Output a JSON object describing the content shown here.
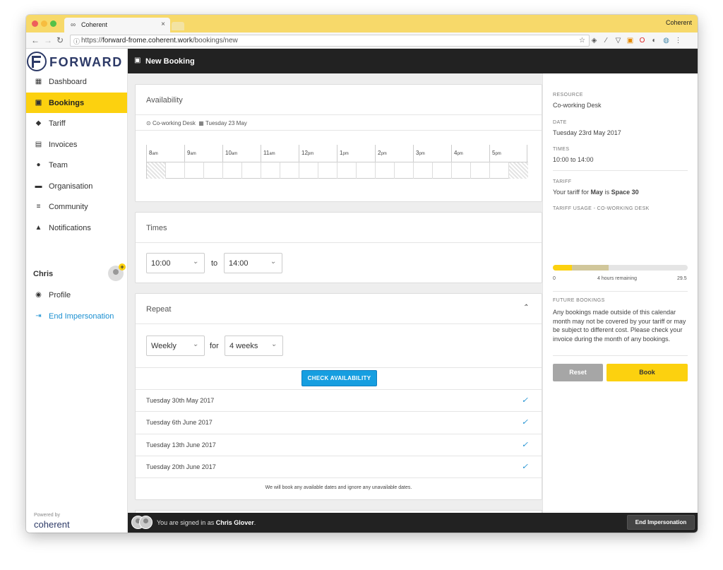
{
  "browser": {
    "tab_title": "Coherent",
    "tab_close": "×",
    "profile_name": "Coherent",
    "url_scheme": "https://",
    "url_host": "forward-frome.coherent.work",
    "url_path": "/bookings/new",
    "traffic_lights": [
      "#ee5f5b",
      "#f7bd3f",
      "#54c148"
    ],
    "extensions": [
      "star-icon",
      "layers-icon",
      "pipette-icon",
      "pocket-icon",
      "off-badge-icon",
      "opera-icon",
      "ghost-icon",
      "globe-icon",
      "more-icon"
    ]
  },
  "sidebar": {
    "brand": "FORWARD",
    "items": [
      {
        "label": "Dashboard",
        "icon": "dashboard-icon",
        "glyph": "▦"
      },
      {
        "label": "Bookings",
        "icon": "calendar-icon",
        "glyph": "▣"
      },
      {
        "label": "Tariff",
        "icon": "tag-icon",
        "glyph": "◆"
      },
      {
        "label": "Invoices",
        "icon": "document-icon",
        "glyph": "▤"
      },
      {
        "label": "Team",
        "icon": "team-icon",
        "glyph": "●"
      },
      {
        "label": "Organisation",
        "icon": "briefcase-icon",
        "glyph": "▬"
      },
      {
        "label": "Community",
        "icon": "directory-icon",
        "glyph": "≡"
      },
      {
        "label": "Notifications",
        "icon": "bell-icon",
        "glyph": "▲"
      }
    ],
    "user": {
      "name": "Chris",
      "badge": "+",
      "profile_label": "Profile",
      "end_label": "End Impersonation"
    },
    "powered_by": "Powered by",
    "powered_logo": "coherent"
  },
  "header": {
    "title": "New Booking"
  },
  "availability": {
    "title": "Availability",
    "resource": "Co-working Desk",
    "date": "Tuesday 23 May",
    "hours": [
      {
        "h": "8",
        "s": "am"
      },
      {
        "h": "9",
        "s": "am"
      },
      {
        "h": "10",
        "s": "am"
      },
      {
        "h": "11",
        "s": "am"
      },
      {
        "h": "12",
        "s": "pm"
      },
      {
        "h": "1",
        "s": "pm"
      },
      {
        "h": "2",
        "s": "pm"
      },
      {
        "h": "3",
        "s": "pm"
      },
      {
        "h": "4",
        "s": "pm"
      },
      {
        "h": "5",
        "s": "pm"
      }
    ]
  },
  "times": {
    "title": "Times",
    "from": "10:00",
    "to_label": "to",
    "to": "14:00"
  },
  "repeat": {
    "title": "Repeat",
    "frequency": "Weekly",
    "for_label": "for",
    "duration": "4 weeks",
    "check_button": "CHECK AVAILABILITY",
    "dates": [
      "Tuesday 30th May 2017",
      "Tuesday 6th June 2017",
      "Tuesday 13th June 2017",
      "Tuesday 20th June 2017"
    ],
    "note": "We will book any available dates and ignore any unavailable dates."
  },
  "summary": {
    "resource_label": "RESOURCE",
    "resource": "Co-working Desk",
    "date_label": "DATE",
    "date": "Tuesday 23rd May 2017",
    "times_label": "TIMES",
    "times": "10:00 to 14:00",
    "tariff_label": "TARIFF",
    "tariff_pre": "Your tariff for",
    "tariff_month": "May",
    "tariff_mid": "is",
    "tariff_name": "Space 30",
    "usage_label": "TARIFF USAGE - CO-WORKING DESK",
    "usage_min": "0",
    "usage_max": "29.5",
    "usage_remaining": "4 hours remaining",
    "usage_used_fraction": 0.14,
    "usage_booking_fraction": 0.27,
    "future_label": "FUTURE BOOKINGS",
    "future_text": "Any bookings made outside of this calendar month may not be covered by your tariff or may be subject to different cost. Please check your invoice during the month of any bookings.",
    "reset": "Reset",
    "book": "Book"
  },
  "footer": {
    "signed_pre": "You are signed in as",
    "signed_name": "Chris Glover",
    "signed_post": ".",
    "end_button": "End Impersonation"
  }
}
